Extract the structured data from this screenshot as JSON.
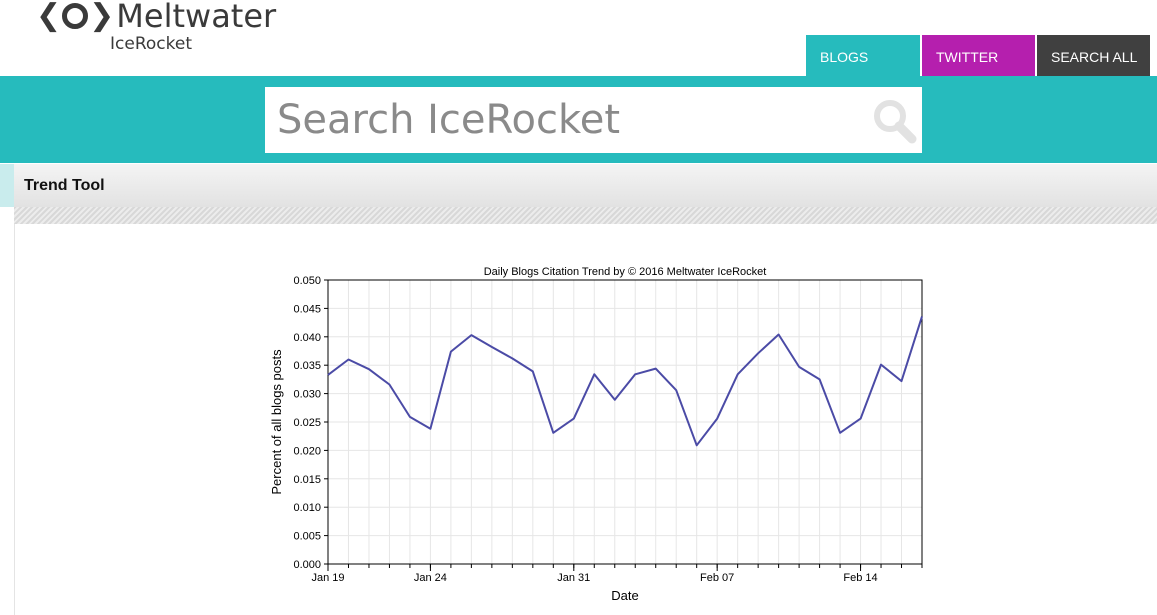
{
  "brand": {
    "name": "Meltwater",
    "product": "IceRocket"
  },
  "nav": {
    "tabs": [
      {
        "label": "BLOGS"
      },
      {
        "label": "TWITTER"
      },
      {
        "label": "SEARCH ALL"
      }
    ]
  },
  "search": {
    "placeholder": "Search IceRocket",
    "value": ""
  },
  "section": {
    "title": "Trend Tool"
  },
  "colors": {
    "teal": "#26bbbd",
    "magenta": "#b51fae",
    "dark": "#404040",
    "line": "#4b4ba6"
  },
  "chart_data": {
    "type": "line",
    "title": "Daily Blogs Citation Trend by © 2016 Meltwater IceRocket",
    "xlabel": "Date",
    "ylabel": "Percent of all blogs posts",
    "ylim": [
      0,
      0.05
    ],
    "yticks": [
      "0.000",
      "0.005",
      "0.010",
      "0.015",
      "0.020",
      "0.025",
      "0.030",
      "0.035",
      "0.040",
      "0.045",
      "0.050"
    ],
    "xlim": [
      "2016-01-19",
      "2016-02-17"
    ],
    "xticks": [
      {
        "date": "2016-01-19",
        "label": "Jan 19"
      },
      {
        "date": "2016-01-24",
        "label": "Jan 24"
      },
      {
        "date": "2016-01-31",
        "label": "Jan 31"
      },
      {
        "date": "2016-02-07",
        "label": "Feb 07"
      },
      {
        "date": "2016-02-14",
        "label": "Feb 14"
      }
    ],
    "grid": true,
    "series": [
      {
        "x": [
          "2016-01-19",
          "2016-01-20",
          "2016-01-21",
          "2016-01-22",
          "2016-01-23",
          "2016-01-24",
          "2016-01-25",
          "2016-01-26",
          "2016-01-27",
          "2016-01-28",
          "2016-01-29",
          "2016-01-30",
          "2016-01-31",
          "2016-02-01",
          "2016-02-02",
          "2016-02-03",
          "2016-02-04",
          "2016-02-05",
          "2016-02-06",
          "2016-02-07",
          "2016-02-08",
          "2016-02-09",
          "2016-02-10",
          "2016-02-11",
          "2016-02-12",
          "2016-02-13",
          "2016-02-14",
          "2016-02-15",
          "2016-02-16",
          "2016-02-17"
        ],
        "values": [
          0.0333,
          0.036,
          0.0343,
          0.0316,
          0.0259,
          0.0238,
          0.0374,
          0.0403,
          0.0382,
          0.0362,
          0.0339,
          0.0231,
          0.0256,
          0.0334,
          0.0289,
          0.0334,
          0.0344,
          0.0306,
          0.0209,
          0.0256,
          0.0334,
          0.0371,
          0.0404,
          0.0347,
          0.0325,
          0.0231,
          0.0256,
          0.0351,
          0.0322,
          0.0436
        ]
      }
    ]
  }
}
